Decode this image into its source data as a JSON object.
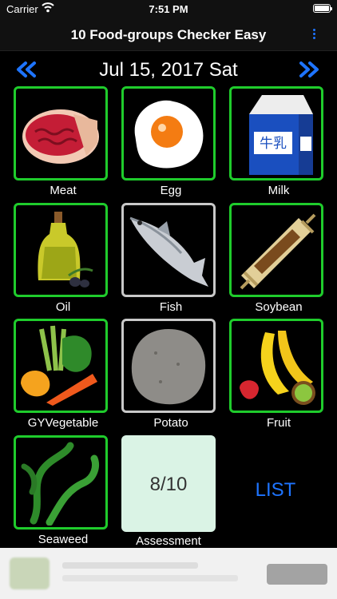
{
  "status": {
    "carrier": "Carrier",
    "time": "7:51 PM"
  },
  "header": {
    "title": "10 Food-groups Checker Easy"
  },
  "date": {
    "label": "Jul 15, 2017 Sat"
  },
  "food_groups": [
    {
      "label": "Meat",
      "checked": true
    },
    {
      "label": "Egg",
      "checked": true
    },
    {
      "label": "Milk",
      "checked": true
    },
    {
      "label": "Oil",
      "checked": true
    },
    {
      "label": "Fish",
      "checked": false
    },
    {
      "label": "Soybean",
      "checked": true
    },
    {
      "label": "GYVegetable",
      "checked": true
    },
    {
      "label": "Potato",
      "checked": false
    },
    {
      "label": "Fruit",
      "checked": true
    },
    {
      "label": "Seaweed",
      "checked": true
    }
  ],
  "milk_carton_text": "牛乳",
  "assessment": {
    "value": "8/10",
    "label": "Assessment"
  },
  "list_button": "LIST",
  "colors": {
    "checked_border": "#1fcc2c",
    "unchecked_border": "#c9c9c9",
    "accent": "#1e74ff",
    "assessment_bg": "#daf3e5"
  }
}
